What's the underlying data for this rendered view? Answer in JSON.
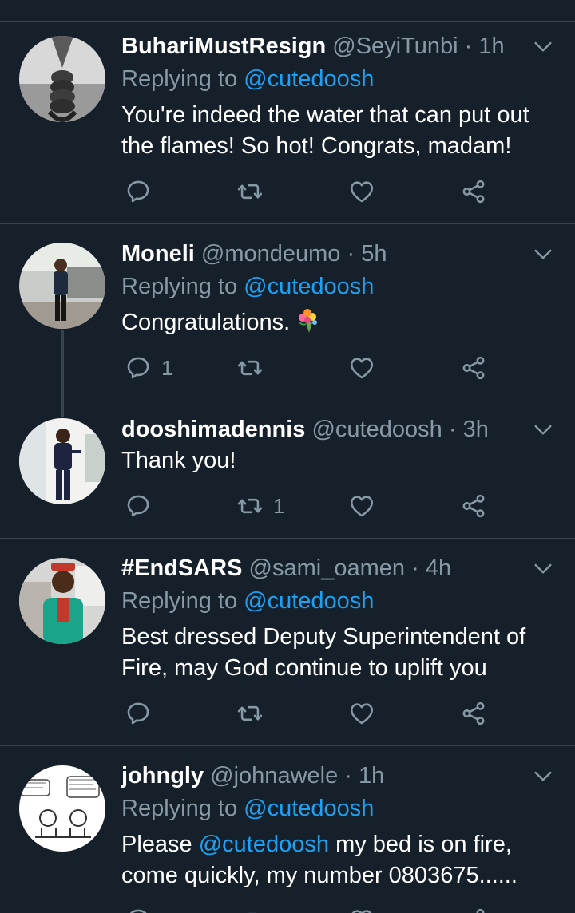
{
  "colors": {
    "background": "#15202b",
    "divider": "#38444d",
    "muted": "#8899a6",
    "link": "#1da1f2"
  },
  "icons": {
    "reply": "reply-icon",
    "retweet": "retweet-icon",
    "like": "heart-icon",
    "share": "share-icon",
    "menu": "chevron-down-icon"
  },
  "replying_prefix": "Replying to",
  "tweets": [
    {
      "name": "BuhariMustResign",
      "handle": "@SeyiTunbi",
      "time": "1h",
      "replying_to": "@cutedoosh",
      "text": "You're indeed the water that can put out the flames! So hot! Congrats, madam!",
      "reply_count": "",
      "retweet_count": "",
      "like_count": ""
    },
    {
      "name": "Moneli",
      "handle": "@mondeumo",
      "time": "5h",
      "replying_to": "@cutedoosh",
      "text": "Congratulations.",
      "emoji": "bouquet-emoji",
      "reply_count": "1",
      "retweet_count": "",
      "like_count": ""
    },
    {
      "name": "dooshimadennis",
      "handle": "@cutedoosh",
      "time": "3h",
      "text": "Thank you!",
      "reply_count": "",
      "retweet_count": "1",
      "like_count": ""
    },
    {
      "name": "#EndSARS",
      "handle": "@sami_oamen",
      "time": "4h",
      "replying_to": "@cutedoosh",
      "text": "Best dressed Deputy Superintendent of Fire, may God continue to uplift you",
      "reply_count": "",
      "retweet_count": "",
      "like_count": ""
    },
    {
      "name": "johngly",
      "handle": "@johnawele",
      "time": "1h",
      "replying_to": "@cutedoosh",
      "text_mention": "@cutedoosh",
      "text_prefix": "Please",
      "text_rest": "my bed is on fire, come quickly, my number 0803675......"
    }
  ]
}
